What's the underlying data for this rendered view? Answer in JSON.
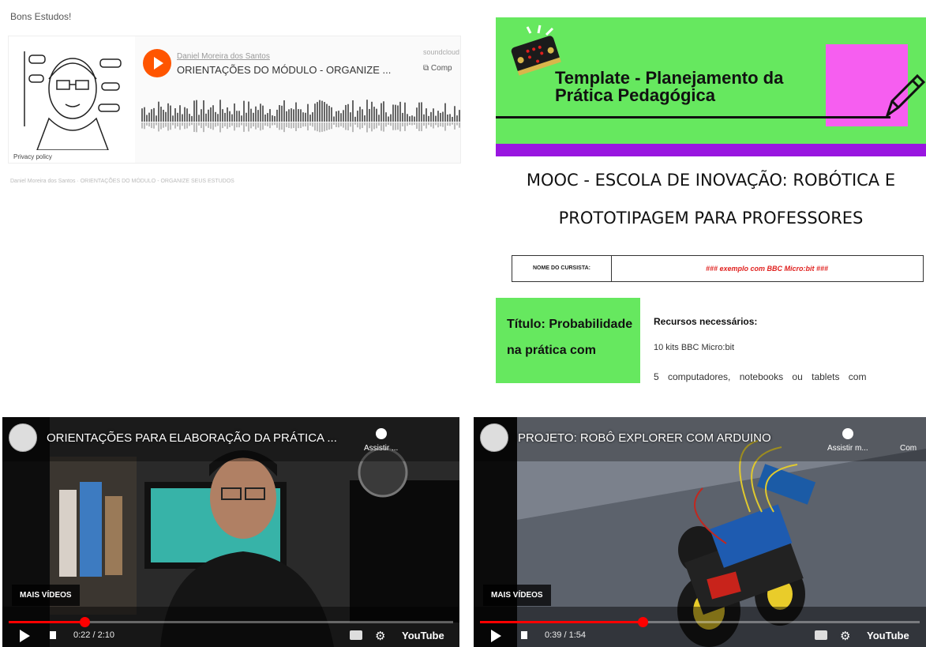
{
  "greeting": "Bons Estudos!",
  "soundcloud": {
    "artist": "Daniel Moreira dos Santos",
    "track": "ORIENTAÇÕES DO MÓDULO - ORGANIZE ...",
    "logo": "soundcloud",
    "share": "Comp",
    "privacy": "Privacy policy",
    "caption": "Daniel Moreira dos Santos · ORIENTAÇÕES DO MÓDULO - ORGANIZE SEUS ESTUDOS",
    "accent": "#ff5500"
  },
  "doc": {
    "title": "Template - Planejamento da Prática Pedagógica",
    "heading_line1": "MOOC - ESCOLA DE INOVAÇÃO: ROBÓTICA E",
    "heading_line2": "PROTOTIPAGEM PARA PROFESSORES",
    "name_label": "NOME DO CURSISTA:",
    "name_value": "### exemplo com BBC Micro:bit ###",
    "title_box": "Título: Probabilidade na prática com",
    "resources_title": "Recursos necessários:",
    "resource_1": "10 kits BBC Micro:bit",
    "resource_2": "5 computadores, notebooks ou tablets com",
    "colors": {
      "green": "#66e85f",
      "purple": "#9916e0",
      "pink": "#f65ef0"
    }
  },
  "videos": [
    {
      "title": "ORIENTAÇÕES PARA ELABORAÇÃO DA PRÁTICA ...",
      "watch_later": "Assistir ...",
      "more_videos": "MAIS VÍDEOS",
      "time": "0:22 / 2:10",
      "progress": 0.17,
      "brand": "YouTube"
    },
    {
      "title": "PROJETO: ROBÔ EXPLORER COM ARDUINO",
      "watch_later": "Assistir m...",
      "share": "Com",
      "more_videos": "MAIS VÍDEOS",
      "time": "0:39 / 1:54",
      "progress": 0.37,
      "brand": "YouTube"
    }
  ]
}
